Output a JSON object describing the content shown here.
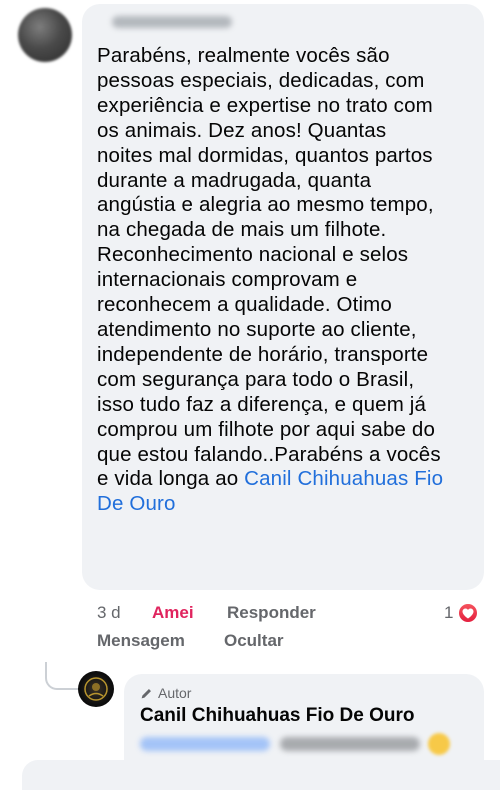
{
  "comment": {
    "text_before_mention": "Parabéns, realmente vocês são\npessoas especiais, dedicadas, com\nexperiência e expertise no trato com\nos animais. Dez anos! Quantas\nnoites mal dormidas, quantos partos\ndurante a madrugada, quanta\nangústia e alegria ao mesmo tempo,\nna chegada de mais um filhote.\nReconhecimento nacional e selos\ninternacionais comprovam e\nreconhecem a qualidade. Otimo\natendimento no suporte ao cliente,\nindependente de horário, transporte\ncom segurança para todo o Brasil,\nisso tudo faz a diferença, e quem já\ncomprou um filhote por aqui sabe do\nque estou falando..Parabéns a vocês\ne vida longa ao ",
    "mention": "Canil Chihuahuas Fio\nDe Ouro"
  },
  "actions": {
    "time": "3 d",
    "amei": "Amei",
    "responder": "Responder",
    "mensagem": "Mensagem",
    "ocultar": "Ocultar"
  },
  "reactions": {
    "count": "1",
    "type": "heart-icon",
    "color": "#e4203f"
  },
  "reply": {
    "badge": "Autor",
    "author": "Canil Chihuahuas Fio De Ouro"
  },
  "colors": {
    "bubble": "#f0f2f5",
    "mention": "#216fdb",
    "liked": "#e0245e",
    "muted": "#65676b"
  }
}
